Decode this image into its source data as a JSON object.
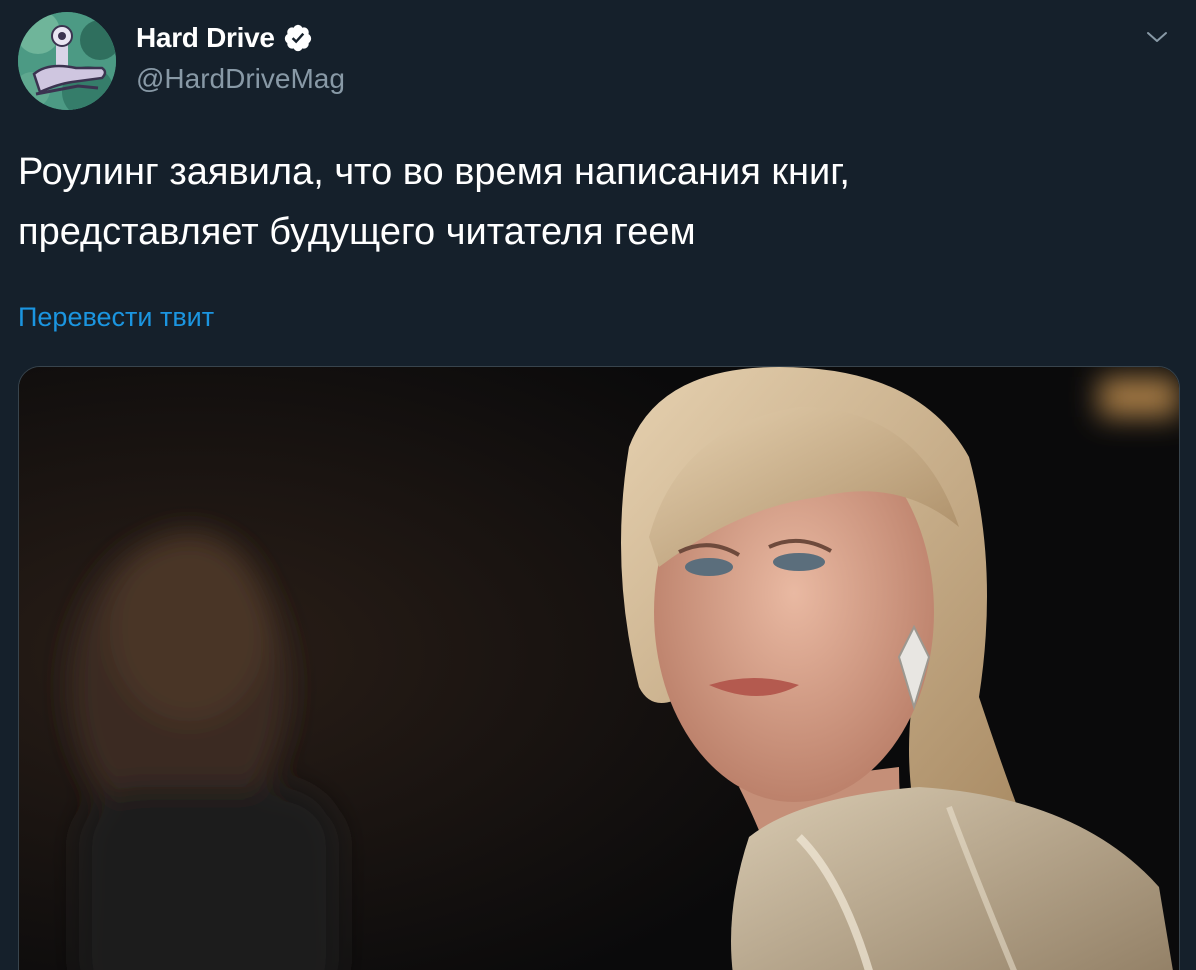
{
  "author": {
    "display_name": "Hard Drive",
    "handle": "@HardDriveMag",
    "verified": true,
    "avatar_icon": "avatar-icon"
  },
  "tweet": {
    "text_lines": [
      "Роулинг заявила, что во время написания книг,",
      "представляет будущего читателя геем"
    ],
    "translate_label": "Перевести твит"
  },
  "media": {
    "type": "photo",
    "description_icon": "photo-icon"
  },
  "icons": {
    "verified": "verified-badge-icon",
    "menu": "chevron-down-icon"
  },
  "colors": {
    "background": "#15202b",
    "text": "#ffffff",
    "secondary_text": "#8899a6",
    "link": "#1b95e0",
    "border": "#38444d"
  }
}
